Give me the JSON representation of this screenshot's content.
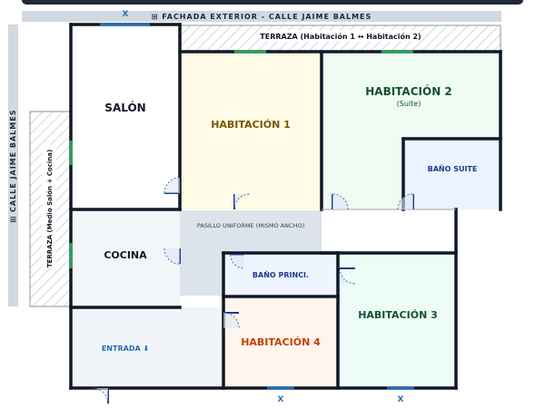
{
  "colors": {
    "wall": "#111827",
    "window": "#2e9e5b",
    "window_blue": "#2b6cb0",
    "door_arc": "#1e3a8a",
    "bar": "#d1d8e0",
    "bar_text": "#1f2937",
    "top_banner": "#1f2937"
  },
  "street": {
    "top_label": "⊞ FACHADA EXTERIOR - CALLE JAIME BALMES",
    "side_label": "⊞ CALLE JAIME BALMES",
    "window_marks": [
      "X",
      "X",
      "X"
    ]
  },
  "terraces": {
    "top": "TERRAZA (Habitación 1 ↔ Habitación 2)",
    "left": "TERRAZA (Medio Salón + Cocina)"
  },
  "rooms": {
    "salon": "SALÓN",
    "hab1": "HABITACIÓN 1",
    "hab2": "HABITACIÓN 2",
    "hab2_sub": "(Suite)",
    "bano_suite": "BAÑO SUITE",
    "pasillo": "PASILLO UNIFORME (MISMO ANCHO)",
    "cocina": "COCINA",
    "bano_princ": "BAÑO PRINCI.",
    "hab3": "HABITACIÓN 3",
    "entrada": "ENTRADA ⬇",
    "hab4": "HABITACIÓN 4"
  },
  "room_colors": {
    "salon": "#ffffff",
    "hab1": "#fffbe6",
    "hab2": "#effcf3",
    "bano_suite": "#eaf3ff",
    "pasillo": "#dde3ea",
    "cocina": "#f3f6f9",
    "bano_princ": "#eef5ff",
    "hab3": "#eefcf8",
    "entrada": "#f1f4f9",
    "hab4": "#fff5ec"
  },
  "label_colors": {
    "salon": "#111827",
    "hab1": "#7a5500",
    "hab2": "#14532d",
    "bano_suite": "#1e3a8a",
    "pasillo": "#374151",
    "cocina": "#111827",
    "bano_princ": "#1e3a8a",
    "hab3": "#14532d",
    "entrada": "#2b6cb0",
    "hab4": "#c2410c"
  }
}
